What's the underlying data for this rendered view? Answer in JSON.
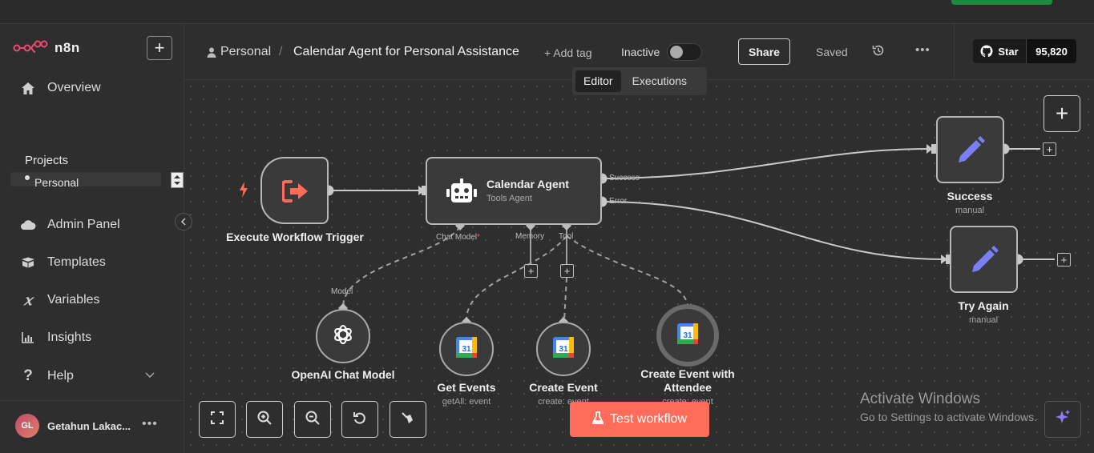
{
  "app": {
    "name": "n8n"
  },
  "sidebar": {
    "overview": "Overview",
    "projects_heading": "Projects",
    "project_item": "Personal",
    "items": [
      {
        "label": "Admin Panel",
        "icon": "cloud-icon"
      },
      {
        "label": "Templates",
        "icon": "box-icon"
      },
      {
        "label": "Variables",
        "icon": "variable-icon"
      },
      {
        "label": "Insights",
        "icon": "chart-icon"
      },
      {
        "label": "Help",
        "icon": "help-icon"
      }
    ],
    "user": {
      "initials": "GL",
      "name": "Getahun Lakac..."
    }
  },
  "header": {
    "owner": "Personal",
    "separator": "/",
    "workflow_name": "Calendar Agent for Personal Assistance",
    "add_tag": "+ Add tag",
    "status_label": "Inactive",
    "share": "Share",
    "saved": "Saved",
    "tabs": [
      "Editor",
      "Executions"
    ],
    "github_star": "Star",
    "github_count": "95,820"
  },
  "canvas": {
    "nodes": {
      "trigger": {
        "label": "Execute Workflow Trigger"
      },
      "agent": {
        "title": "Calendar Agent",
        "subtitle": "Tools Agent",
        "ports": {
          "success": "Success",
          "error": "Error",
          "chat_model": "Chat Model",
          "required": "*",
          "memory": "Memory",
          "tool": "Tool"
        }
      },
      "success": {
        "label": "Success",
        "sub": "manual"
      },
      "try_again": {
        "label": "Try Again",
        "sub": "manual"
      },
      "openai": {
        "label": "OpenAI Chat Model",
        "port": "Model"
      },
      "get_events": {
        "label": "Get Events",
        "sub": "getAll: event"
      },
      "create_event": {
        "label": "Create Event",
        "sub": "create: event"
      },
      "create_attendee": {
        "label_line1": "Create Event with",
        "label_line2": "Attendee",
        "sub": "create: event"
      }
    },
    "test_button": "Test workflow",
    "gcal_day": "31"
  },
  "watermark": {
    "line1": "Activate Windows",
    "line2": "Go to Settings to activate Windows."
  },
  "colors": {
    "accent": "#ff6d5a",
    "edit_icon": "#7b7ff5",
    "success_green": "#1d8a3f"
  }
}
